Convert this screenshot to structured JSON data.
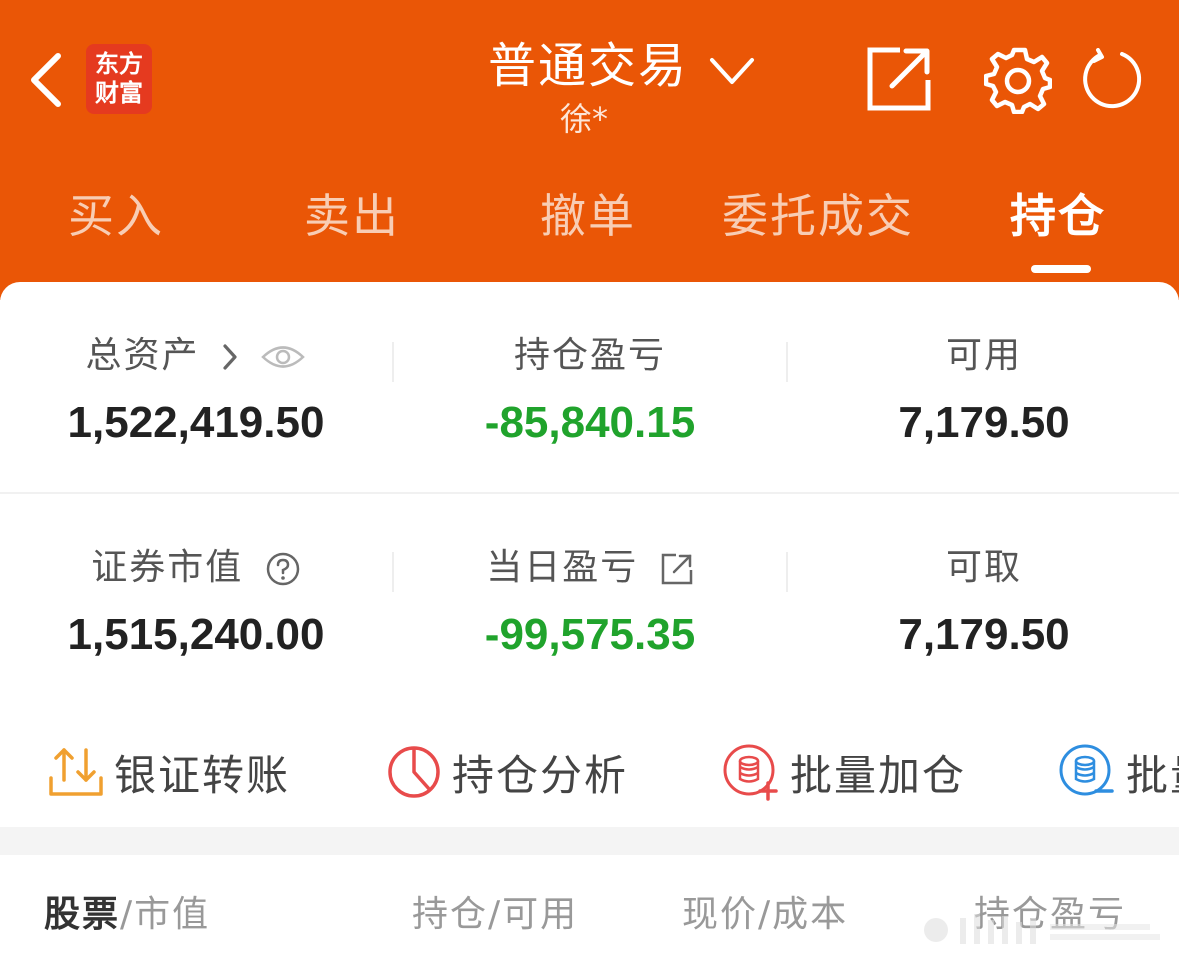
{
  "header": {
    "logo_line1": "东方",
    "logo_line2": "财富",
    "title": "普通交易",
    "subtitle": "徐*",
    "icons": [
      "back-icon",
      "share-icon",
      "gear-icon",
      "refresh-icon",
      "chevron-down-icon"
    ]
  },
  "tabs": [
    {
      "label": "买入"
    },
    {
      "label": "卖出"
    },
    {
      "label": "撤单"
    },
    {
      "label": "委托成交"
    },
    {
      "label": "持仓",
      "active": true
    }
  ],
  "summary": {
    "total_assets": {
      "label": "总资产",
      "value": "1,522,419.50"
    },
    "position_pnl": {
      "label": "持仓盈亏",
      "value": "-85,840.15"
    },
    "available": {
      "label": "可用",
      "value": "7,179.50"
    },
    "market_value": {
      "label": "证券市值",
      "value": "1,515,240.00"
    },
    "today_pnl": {
      "label": "当日盈亏",
      "value": "-99,575.35"
    },
    "withdrawable": {
      "label": "可取",
      "value": "7,179.50"
    }
  },
  "actions": [
    {
      "label": "银证转账",
      "icon": "transfer-icon"
    },
    {
      "label": "持仓分析",
      "icon": "pie-chart-icon"
    },
    {
      "label": "批量加仓",
      "icon": "batch-add-icon"
    },
    {
      "label": "批量",
      "icon": "batch-reduce-icon"
    }
  ],
  "table_header": {
    "col1_main": "股票",
    "col1_sub": "市值",
    "col2_a": "持仓",
    "col2_b": "可用",
    "col3_a": "现价",
    "col3_b": "成本",
    "col4": "持仓盈亏"
  },
  "colors": {
    "brand_orange": "#ea5606",
    "loss_green": "#20a32c",
    "action_orange": "#f0a030",
    "action_red": "#e84b4b",
    "action_blue": "#2e8ee0"
  }
}
